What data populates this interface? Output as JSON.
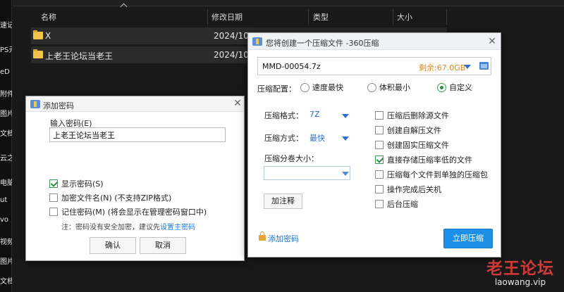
{
  "sidebar": {
    "fragments": [
      "速记",
      "PS元",
      "eD",
      "附件",
      "图片",
      "文档",
      "云之",
      "电脑",
      "ut",
      "vo",
      "视频",
      "图片",
      "文档"
    ]
  },
  "explorer": {
    "columns": [
      "名称",
      "修改日期",
      "类型",
      "大小"
    ],
    "rows": [
      {
        "name": "X",
        "date": "2024/10/"
      },
      {
        "name": "上老王论坛当老王",
        "date": "2024/10/"
      }
    ]
  },
  "password_dialog": {
    "title": "添加密码",
    "input_label": "输入密码(E)",
    "input_value": "上老王论坛当老王",
    "show_password": {
      "label": "显示密码(S)",
      "checked": true
    },
    "encrypt_names": {
      "label": "加密文件名(N) (不支持ZIP格式)",
      "checked": false
    },
    "remember": {
      "label": "记住密码(M) (将会显示在管理密码窗口中)",
      "checked": false
    },
    "note_text": "注：密码没有安全加密，建议先",
    "note_link": "设置主密码",
    "ok_label": "确认",
    "cancel_label": "取消"
  },
  "zip_dialog": {
    "title": "您将创建一个压缩文件 -360压缩",
    "filename": "MMD-00054.7z",
    "free_space": "剩余:67.0GB",
    "config_label": "压缩配置：",
    "radio_options": [
      {
        "label": "速度最快",
        "checked": false
      },
      {
        "label": "体积最小",
        "checked": false
      },
      {
        "label": "自定义",
        "checked": true
      }
    ],
    "format_label": "压缩格式：",
    "format_value": "7Z",
    "method_label": "压缩方式：",
    "method_value": "最快",
    "split_label": "压缩分卷大小：",
    "comment_button": "加注释",
    "options": [
      {
        "label": "压缩后删除源文件",
        "checked": false
      },
      {
        "label": "创建自解压文件",
        "checked": false
      },
      {
        "label": "创建固实压缩文件",
        "checked": false
      },
      {
        "label": "直接存储压缩率低的文件",
        "checked": true
      },
      {
        "label": "压缩每个文件到单独的压缩包",
        "checked": false
      },
      {
        "label": "操作完成后关机",
        "checked": false
      },
      {
        "label": "后台压缩",
        "checked": false
      }
    ],
    "add_password_link": "添加密码",
    "compress_button": "立即压缩"
  },
  "watermark": {
    "cn": "老王论坛",
    "en": "laowang.vip"
  },
  "colors": {
    "accent_blue": "#1e8fe6",
    "free_space": "#e08a1e",
    "check_green": "#2e8b47",
    "watermark_red": "#d23a3a"
  }
}
